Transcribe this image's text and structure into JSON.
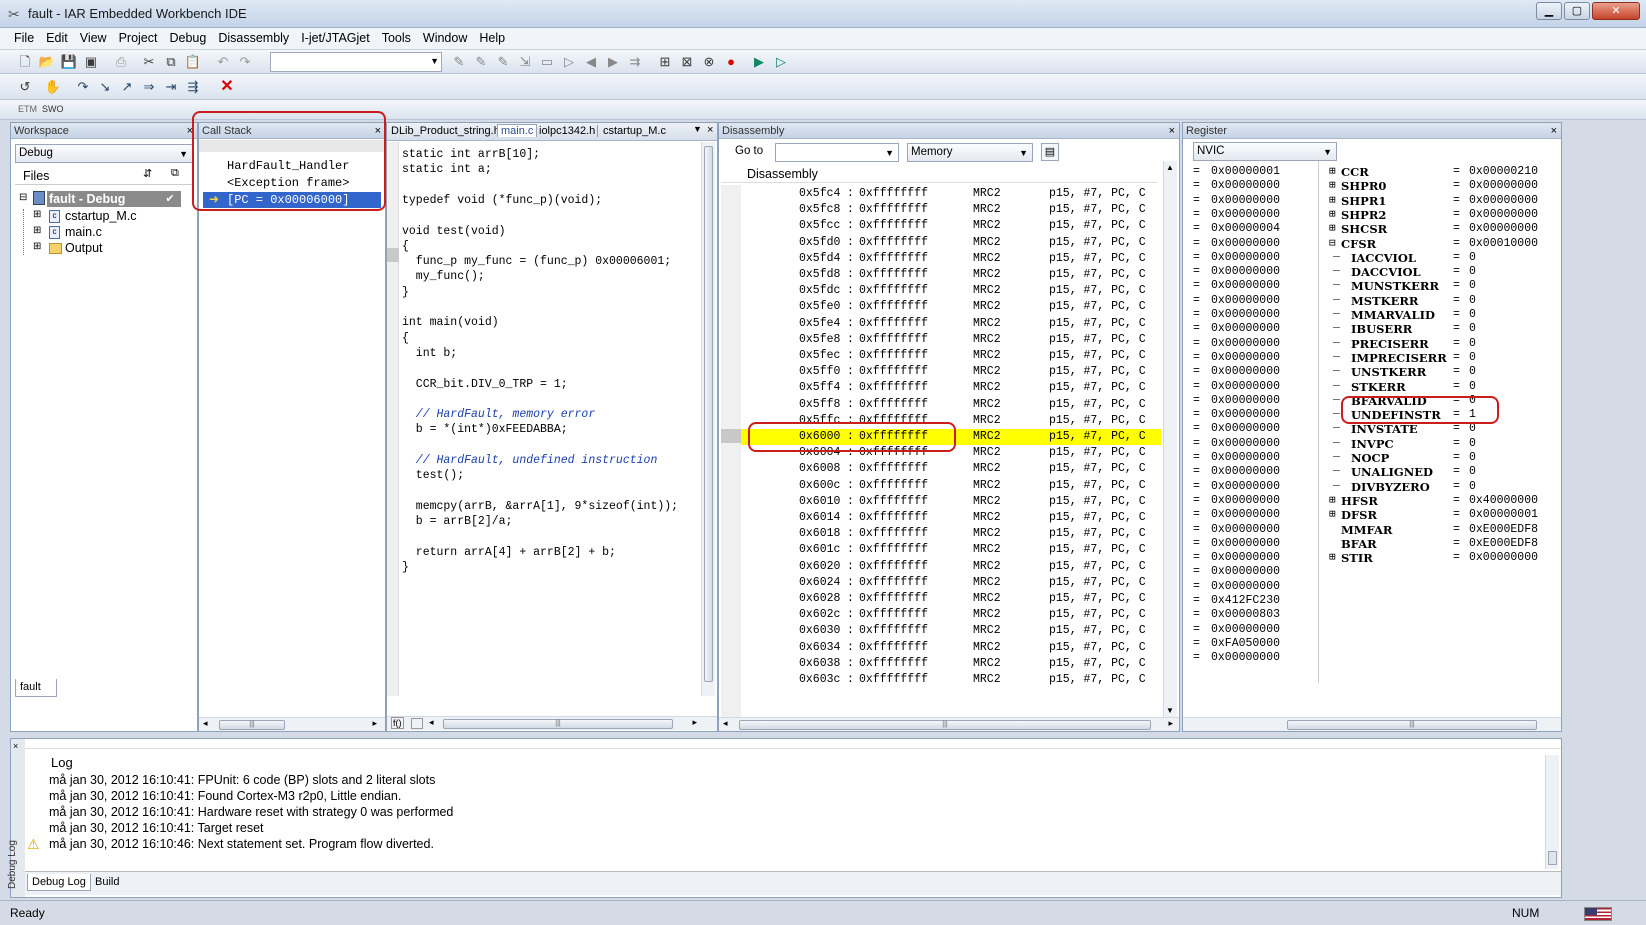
{
  "window": {
    "title": "fault - IAR Embedded Workbench IDE"
  },
  "menu": [
    "File",
    "Edit",
    "View",
    "Project",
    "Debug",
    "Disassembly",
    "I-jet/JTAGjet",
    "Tools",
    "Window",
    "Help"
  ],
  "toolbar3": {
    "etm": "ETM",
    "swo": "SWO"
  },
  "workspace": {
    "header": "Workspace",
    "config": "Debug",
    "files_label": "Files",
    "root": "fault - Debug",
    "items": [
      "cstartup_M.c",
      "main.c",
      "Output"
    ],
    "tab": "fault"
  },
  "callstack": {
    "header": "Call Stack",
    "lines": [
      "HardFault_Handler",
      "<Exception frame>",
      "[PC = 0x00006000]"
    ]
  },
  "editor": {
    "tabs": [
      "DLib_Product_string.h",
      "main.c",
      "iolpc1342.h",
      "cstartup_M.c"
    ],
    "active_tab": "main.c",
    "lines": [
      "static int arrB[10];",
      "static int a;",
      "",
      "typedef void (*func_p)(void);",
      "",
      "void test(void)",
      "{",
      "  func_p my_func = (func_p) 0x00006001;",
      "  my_func();",
      "}",
      "",
      "int main(void)",
      "{",
      "  int b;",
      "",
      "  CCR_bit.DIV_0_TRP = 1;",
      "",
      "  // HardFault, memory error",
      "  b = *(int*)0xFEEDABBA;",
      "",
      "  // HardFault, undefined instruction",
      "  test();",
      "",
      "  memcpy(arrB, &arrA[1], 9*sizeof(int));",
      "  b = arrB[2]/a;",
      "",
      "  return arrA[4] + arrB[2] + b;",
      "}"
    ]
  },
  "disassembly": {
    "header": "Disassembly",
    "goto_label": "Go to",
    "memory_combo": "Memory",
    "title": "Disassembly",
    "highlight_addr": "0x6000",
    "rows": [
      {
        "addr": "0x5fc4",
        "val": "0xffffffff"
      },
      {
        "addr": "0x5fc8",
        "val": "0xffffffff"
      },
      {
        "addr": "0x5fcc",
        "val": "0xffffffff"
      },
      {
        "addr": "0x5fd0",
        "val": "0xffffffff"
      },
      {
        "addr": "0x5fd4",
        "val": "0xffffffff"
      },
      {
        "addr": "0x5fd8",
        "val": "0xffffffff"
      },
      {
        "addr": "0x5fdc",
        "val": "0xffffffff"
      },
      {
        "addr": "0x5fe0",
        "val": "0xffffffff"
      },
      {
        "addr": "0x5fe4",
        "val": "0xffffffff"
      },
      {
        "addr": "0x5fe8",
        "val": "0xffffffff"
      },
      {
        "addr": "0x5fec",
        "val": "0xffffffff"
      },
      {
        "addr": "0x5ff0",
        "val": "0xffffffff"
      },
      {
        "addr": "0x5ff4",
        "val": "0xffffffff"
      },
      {
        "addr": "0x5ff8",
        "val": "0xffffffff"
      },
      {
        "addr": "0x5ffc",
        "val": "0xffffffff"
      },
      {
        "addr": "0x6000",
        "val": "0xffffffff"
      },
      {
        "addr": "0x6004",
        "val": "0xffffffff"
      },
      {
        "addr": "0x6008",
        "val": "0xffffffff"
      },
      {
        "addr": "0x600c",
        "val": "0xffffffff"
      },
      {
        "addr": "0x6010",
        "val": "0xffffffff"
      },
      {
        "addr": "0x6014",
        "val": "0xffffffff"
      },
      {
        "addr": "0x6018",
        "val": "0xffffffff"
      },
      {
        "addr": "0x601c",
        "val": "0xffffffff"
      },
      {
        "addr": "0x6020",
        "val": "0xffffffff"
      },
      {
        "addr": "0x6024",
        "val": "0xffffffff"
      },
      {
        "addr": "0x6028",
        "val": "0xffffffff"
      },
      {
        "addr": "0x602c",
        "val": "0xffffffff"
      },
      {
        "addr": "0x6030",
        "val": "0xffffffff"
      },
      {
        "addr": "0x6034",
        "val": "0xffffffff"
      },
      {
        "addr": "0x6038",
        "val": "0xffffffff"
      },
      {
        "addr": "0x603c",
        "val": "0xffffffff"
      }
    ],
    "mnemonic": "MRC2",
    "operands": "p15, #7, PC, C"
  },
  "register": {
    "header": "Register",
    "group": "NVIC",
    "left_values": [
      "0x00000001",
      "0x00000000",
      "0x00000000",
      "0x00000000",
      "0x00000004",
      "0x00000000",
      "0x00000000",
      "0x00000000",
      "0x00000000",
      "0x00000000",
      "0x00000000",
      "0x00000000",
      "0x00000000",
      "0x00000000",
      "0x00000000",
      "0x00000000",
      "0x00000000",
      "0x00000000",
      "0x00000000",
      "0x00000000",
      "0x00000000",
      "0x00000000",
      "0x00000000",
      "0x00000000",
      "0x00000000",
      "0x00000000",
      "0x00000000",
      "0x00000000",
      "0x00000000",
      "0x00000000",
      "0x412FC230",
      "0x00000803",
      "0x00000000",
      "0xFA050000",
      "0x00000000"
    ],
    "right": [
      {
        "name": "CCR",
        "value": "0x00000210",
        "level": 0,
        "expander": "+"
      },
      {
        "name": "SHPR0",
        "value": "0x00000000",
        "level": 0,
        "expander": "+"
      },
      {
        "name": "SHPR1",
        "value": "0x00000000",
        "level": 0,
        "expander": "+"
      },
      {
        "name": "SHPR2",
        "value": "0x00000000",
        "level": 0,
        "expander": "+"
      },
      {
        "name": "SHCSR",
        "value": "0x00000000",
        "level": 0,
        "expander": "+"
      },
      {
        "name": "CFSR",
        "value": "0x00010000",
        "level": 0,
        "expander": "-"
      },
      {
        "name": "IACCVIOL",
        "value": "0",
        "level": 1
      },
      {
        "name": "DACCVIOL",
        "value": "0",
        "level": 1
      },
      {
        "name": "MUNSTKERR",
        "value": "0",
        "level": 1
      },
      {
        "name": "MSTKERR",
        "value": "0",
        "level": 1
      },
      {
        "name": "MMARVALID",
        "value": "0",
        "level": 1
      },
      {
        "name": "IBUSERR",
        "value": "0",
        "level": 1
      },
      {
        "name": "PRECISERR",
        "value": "0",
        "level": 1
      },
      {
        "name": "IMPRECISERR",
        "value": "0",
        "level": 1
      },
      {
        "name": "UNSTKERR",
        "value": "0",
        "level": 1
      },
      {
        "name": "STKERR",
        "value": "0",
        "level": 1
      },
      {
        "name": "BFARVALID",
        "value": "0",
        "level": 1
      },
      {
        "name": "UNDEFINSTR",
        "value": "1",
        "level": 1
      },
      {
        "name": "INVSTATE",
        "value": "0",
        "level": 1
      },
      {
        "name": "INVPC",
        "value": "0",
        "level": 1
      },
      {
        "name": "NOCP",
        "value": "0",
        "level": 1
      },
      {
        "name": "UNALIGNED",
        "value": "0",
        "level": 1
      },
      {
        "name": "DIVBYZERO",
        "value": "0",
        "level": 1
      },
      {
        "name": "HFSR",
        "value": "0x40000000",
        "level": 0,
        "expander": "+"
      },
      {
        "name": "DFSR",
        "value": "0x00000001",
        "level": 0,
        "expander": "+"
      },
      {
        "name": "MMFAR",
        "value": "0xE000EDF8",
        "level": 0
      },
      {
        "name": "BFAR",
        "value": "0xE000EDF8",
        "level": 0
      },
      {
        "name": "STIR",
        "value": "0x00000000",
        "level": 0,
        "expander": "+"
      }
    ]
  },
  "log": {
    "title": "Log",
    "side_label": "Debug Log",
    "lines": [
      "må jan 30, 2012 16:10:41: FPUnit: 6 code (BP) slots and 2 literal slots",
      "må jan 30, 2012 16:10:41: Found Cortex-M3 r2p0, Little endian.",
      "må jan 30, 2012 16:10:41: Hardware reset with strategy 0 was performed",
      "må jan 30, 2012 16:10:41: Target reset",
      "må jan 30, 2012 16:10:46: Next statement set. Program flow diverted."
    ],
    "tabs": [
      "Debug Log",
      "Build"
    ]
  },
  "status": {
    "left": "Ready",
    "num": "NUM"
  },
  "colors": {
    "highlight": "#ffff00",
    "callout": "#cc1d1d",
    "selection": "#3366cc"
  }
}
